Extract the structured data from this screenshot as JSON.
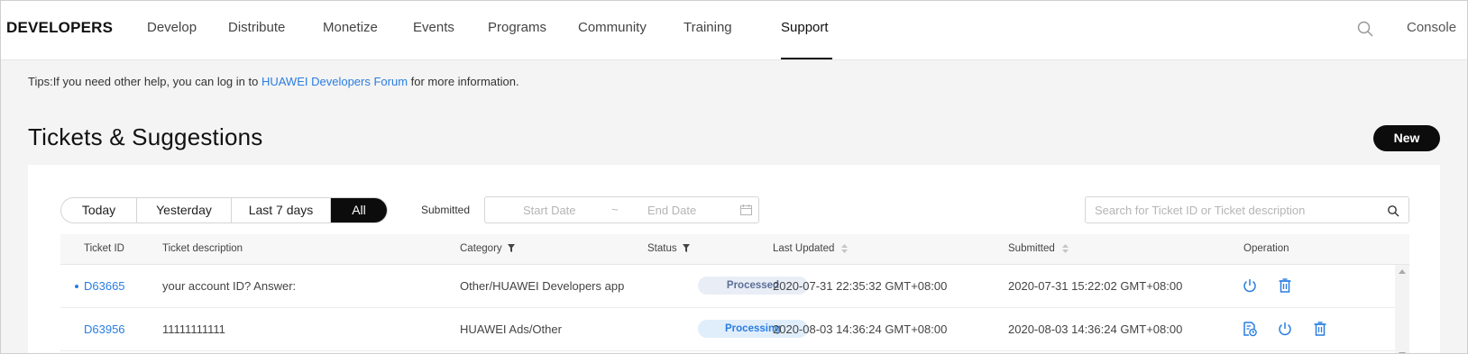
{
  "nav": {
    "brand": "DEVELOPERS",
    "items": [
      "Develop",
      "Distribute",
      "Monetize",
      "Events",
      "Programs",
      "Community",
      "Training",
      "Support"
    ],
    "active": "Support",
    "search_icon": "search-icon",
    "console": "Console"
  },
  "tips": {
    "prefix": "Tips:If you need other help, you can log in to ",
    "link": "HUAWEI Developers Forum",
    "suffix": " for more information."
  },
  "page": {
    "title": "Tickets & Suggestions",
    "new_button": "New"
  },
  "filters": {
    "ranges": [
      "Today",
      "Yesterday",
      "Last 7 days",
      "All"
    ],
    "selected_range": "All",
    "submitted_label": "Submitted",
    "start_placeholder": "Start Date",
    "separator": "~",
    "end_placeholder": "End Date",
    "search_placeholder": "Search for Ticket ID or Ticket description"
  },
  "table": {
    "headers": {
      "id": "Ticket ID",
      "description": "Ticket description",
      "category": "Category",
      "status": "Status",
      "last_updated": "Last Updated",
      "submitted": "Submitted",
      "operation": "Operation"
    },
    "rows": [
      {
        "id": "D63665",
        "unread": true,
        "description": "your account ID? Answer:",
        "category": "Other/HUAWEI Developers app",
        "status": "Processed",
        "last_updated": "2020-07-31 22:35:32 GMT+08:00",
        "submitted": "2020-07-31 15:22:02 GMT+08:00",
        "operations": [
          "power-icon",
          "trash-icon"
        ]
      },
      {
        "id": "D63956",
        "unread": false,
        "description": "11111111111",
        "category": "HUAWEI Ads/Other",
        "status": "Processing",
        "last_updated": "2020-08-03 14:36:24 GMT+08:00",
        "submitted": "2020-08-03 14:36:24 GMT+08:00",
        "operations": [
          "document-clock-icon",
          "power-icon",
          "trash-icon"
        ]
      }
    ]
  },
  "colors": {
    "accent": "#2a7de1",
    "primary_button": "#0c0c0c",
    "page_background": "#f4f4f4"
  }
}
